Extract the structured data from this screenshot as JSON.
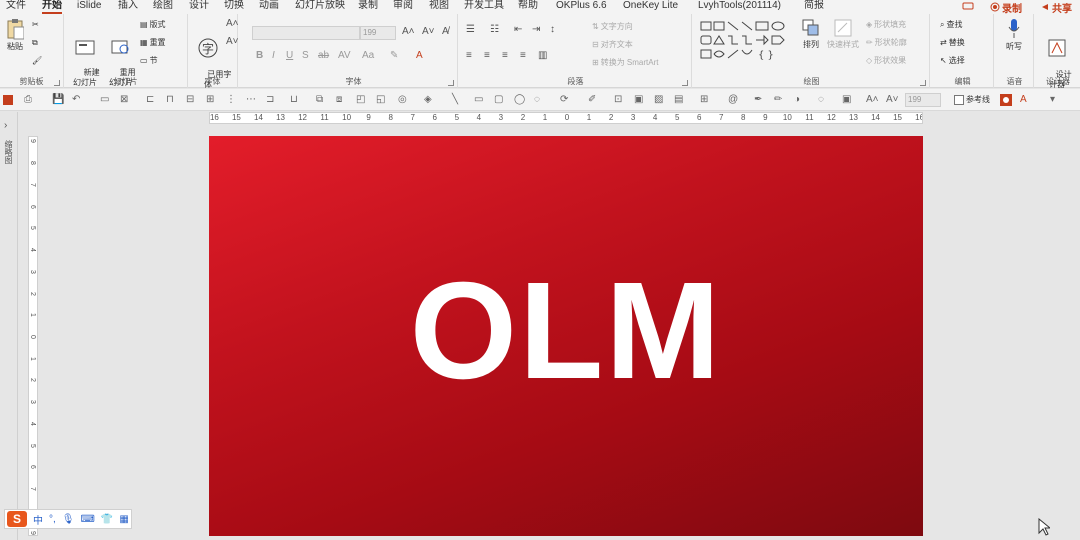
{
  "menu": {
    "items": [
      {
        "label": "文件"
      },
      {
        "label": "开始"
      },
      {
        "label": "iSlide"
      },
      {
        "label": "插入"
      },
      {
        "label": "绘图"
      },
      {
        "label": "设计"
      },
      {
        "label": "切换"
      },
      {
        "label": "动画"
      },
      {
        "label": "幻灯片放映"
      },
      {
        "label": "录制"
      },
      {
        "label": "审阅"
      },
      {
        "label": "视图"
      },
      {
        "label": "开发工具"
      },
      {
        "label": "帮助"
      },
      {
        "label": "OKPlus 6.6"
      },
      {
        "label": "OneKey Lite"
      },
      {
        "label": "LvyhTools(201114)"
      },
      {
        "label": "简报"
      }
    ],
    "record_label": "录制",
    "share_label": "共享"
  },
  "ribbon": {
    "clipboard": {
      "paste": "粘贴",
      "group": "剪贴板"
    },
    "slides": {
      "new_slide": "新建\n幻灯片",
      "reuse": "重用\n幻灯片",
      "layout": "版式",
      "reset": "重置",
      "section": "节",
      "group": "幻灯片"
    },
    "font_group": {
      "used_fonts": "已用字\n体",
      "group": "字体"
    },
    "font": {
      "font_size": "199",
      "group": "字体"
    },
    "paragraph": {
      "text_direction": "文字方向",
      "align_text": "对齐文本",
      "smartart": "转换为 SmartArt",
      "group": "段落"
    },
    "drawing": {
      "arrange": "排列",
      "quick_styles": "快速样式",
      "fill": "形状填充",
      "outline": "形状轮廓",
      "effects": "形状效果",
      "group": "绘图"
    },
    "editing": {
      "find": "查找",
      "replace": "替换",
      "select": "选择",
      "group": "编辑"
    },
    "voice": {
      "dictate": "听写",
      "group": "语音"
    },
    "designer": {
      "label": "设计\n计器",
      "group": "设计器"
    }
  },
  "qat": {
    "font_size": "199",
    "guides": "参考线"
  },
  "left_pane": {
    "label": "缩略图"
  },
  "ruler": {
    "h_ticks": [
      "16",
      "15",
      "14",
      "13",
      "12",
      "11",
      "10",
      "9",
      "8",
      "7",
      "6",
      "5",
      "4",
      "3",
      "2",
      "1",
      "0",
      "1",
      "2",
      "3",
      "4",
      "5",
      "6",
      "7",
      "8",
      "9",
      "10",
      "11",
      "12",
      "13",
      "14",
      "15",
      "16"
    ],
    "v_ticks": [
      "9",
      "8",
      "7",
      "6",
      "5",
      "4",
      "3",
      "2",
      "1",
      "0",
      "1",
      "2",
      "3",
      "4",
      "5",
      "6",
      "7",
      "8",
      "9"
    ]
  },
  "slide": {
    "title": "OLM",
    "colors": {
      "start": "#e31d2a",
      "end": "#7e0a10"
    }
  },
  "ime": {
    "logo": "S",
    "lang": "中"
  },
  "colors": {
    "accent": "#c43e1c"
  }
}
